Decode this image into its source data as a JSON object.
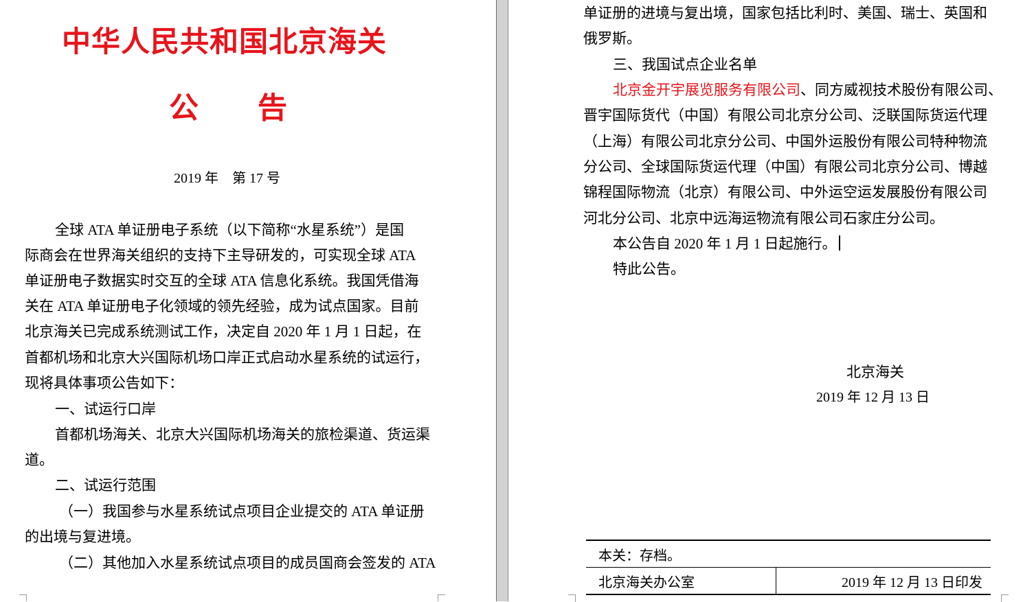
{
  "left_page": {
    "title": "中华人民共和国北京海关",
    "subtitle": [
      "公",
      "告"
    ],
    "doc_number": "2019 年　第 17 号",
    "body_lines": [
      "全球 ATA 单证册电子系统（以下简称“水星系统”）是国",
      "际商会在世界海关组织的支持下主导研发的，可实现全球 ATA",
      "单证册电子数据实时交互的全球 ATA 信息化系统。我国凭借海",
      "关在 ATA 单证册电子化领域的领先经验，成为试点国家。目前",
      "北京海关已完成系统测试工作，决定自 2020 年 1 月 1 日起，在",
      "首都机场和北京大兴国际机场口岸正式启动水星系统的试运行，",
      "现将具体事项公告如下：",
      "一、试运行口岸",
      "首都机场海关、北京大兴国际机场海关的旅检渠道、货运渠",
      "道。",
      "二、试运行范围",
      "（一）我国参与水星系统试点项目企业提交的 ATA 单证册",
      "的出境与复进境。",
      "（二）其他加入水星系统试点项目的成员国商会签发的 ATA"
    ]
  },
  "right_page": {
    "continued_lines": [
      "单证册的进境与复出境，国家包括比利时、美国、瑞士、英国和",
      "俄罗斯。"
    ],
    "section3_heading": "三、我国试点企业名单",
    "company_highlight": "北京金开宇展览服务有限公司",
    "company_lines": [
      "、同方威视技术股份有限公司、",
      "晋宇国际货代（中国）有限公司北京分公司、泛联国际货运代理",
      "（上海）有限公司北京分公司、中国外运股份有限公司特种物流",
      "分公司、全球国际货运代理（中国）有限公司北京分公司、博越",
      "锦程国际物流（北京）有限公司、中外运空运发展股份有限公司",
      "河北分公司、北京中远海运物流有限公司石家庄分公司。"
    ],
    "effective": "本公告自 2020 年 1 月 1 日起施行。",
    "closing": "特此公告。",
    "signature": "北京海关",
    "sign_date": "2019 年 12 月 13 日",
    "footer": {
      "cc": "本关：存档。",
      "office": "北京海关办公室",
      "print_date": "2019 年 12 月 13 日印发"
    }
  },
  "icons": {
    "paste_options": "paste-options-icon"
  },
  "colors": {
    "title_red": "#e8141b",
    "highlight_red": "#e8141b",
    "gutter_gray": "#d2d2d2"
  }
}
